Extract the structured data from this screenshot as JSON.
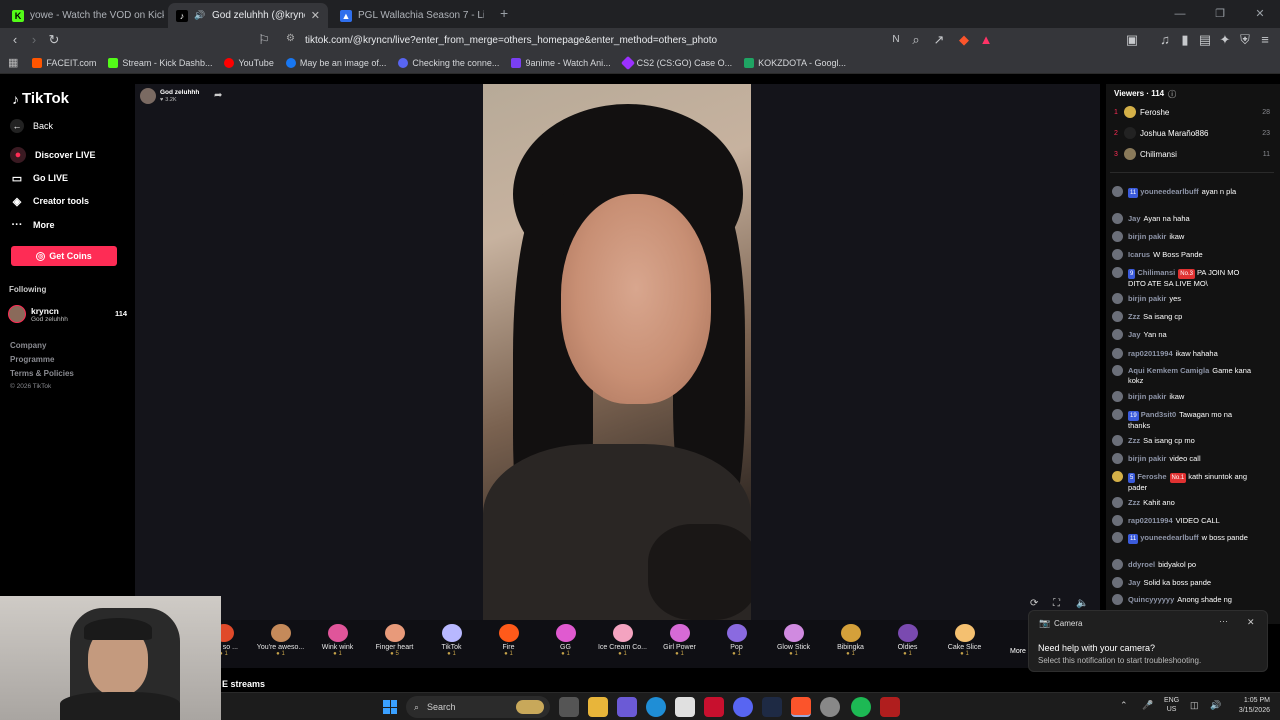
{
  "tabs": [
    {
      "title": "yowe - Watch the VOD on Kick",
      "icon": "kick-icon",
      "color": "#53fc18"
    },
    {
      "title": "God zeluhhh (@kryncn) is LIV",
      "icon": "tiktok-icon",
      "color": "#000000"
    },
    {
      "title": "PGL Wallachia Season 7 - Liquipedia",
      "icon": "liquipedia-icon",
      "color": "#2f6fed"
    }
  ],
  "url": "tiktok.com/@kryncn/live?enter_from_merge=others_homepage&enter_method=others_photo",
  "bookmarks": [
    {
      "label": "FACEIT.com",
      "color": "#ff5500"
    },
    {
      "label": "Stream - Kick Dashb...",
      "color": "#53fc18"
    },
    {
      "label": "YouTube",
      "color": "#ff0000"
    },
    {
      "label": "May be an image of...",
      "color": "#1877f2"
    },
    {
      "label": "Checking the conne...",
      "color": "#5865f2"
    },
    {
      "label": "9anime - Watch Ani...",
      "color": "#7a3ff2"
    },
    {
      "label": "CS2 (CS:GO) Case O...",
      "color": "#9b30ff"
    },
    {
      "label": "KOKZDOTA - Googl...",
      "color": "#1fa463"
    }
  ],
  "nav": {
    "logo": "TikTok",
    "back": "Back",
    "discover": "Discover LIVE",
    "golive": "Go LIVE",
    "creator": "Creator tools",
    "more": "More",
    "coins": "Get Coins",
    "following": "Following",
    "follow_user": "kryncn",
    "follow_sub": "God zeluhhh",
    "follow_count": "114",
    "company": "Company",
    "programme": "Programme",
    "terms": "Terms & Policies",
    "copyright": "© 2026 TikTok"
  },
  "host": {
    "name": "God zeluhhh",
    "likes": "3.2K"
  },
  "viewers": {
    "title": "Viewers · 114",
    "top": [
      {
        "rank": "1",
        "name": "Feroshe",
        "count": "28",
        "color": "#d4b048"
      },
      {
        "rank": "2",
        "name": "Joshua Maraño886",
        "count": "23",
        "color": "#222222"
      },
      {
        "rank": "3",
        "name": "Chilimansi",
        "count": "11",
        "color": "#8a7a5a"
      }
    ]
  },
  "chat": [
    {
      "badge": "11",
      "name": "youneedearlbuff",
      "text": "ayan n pla"
    },
    {
      "badge": "",
      "name": "Jay",
      "text": "Ayan na haha"
    },
    {
      "badge": "",
      "name": "birjin pakir",
      "text": "ikaw"
    },
    {
      "badge": "",
      "name": "Icarus",
      "text": "W Boss Pande"
    },
    {
      "badge": "9",
      "name": "Chilimansi",
      "badge2": "No.3",
      "text": "PA JOIN MO DITO ATE SA LIVE MO\\"
    },
    {
      "badge": "",
      "name": "birjin pakir",
      "text": "yes"
    },
    {
      "badge": "",
      "name": "Zzz",
      "text": "Sa isang cp"
    },
    {
      "badge": "",
      "name": "Jay",
      "text": "Yan na"
    },
    {
      "badge": "",
      "name": "rap02011994",
      "text": "ikaw hahaha"
    },
    {
      "badge": "",
      "name": "Aqui Kemkem Camigla",
      "text": "Game kana kokz"
    },
    {
      "badge": "",
      "name": "birjin pakir",
      "text": "ikaw"
    },
    {
      "badge": "19",
      "name": "Pand3sit0",
      "text": "Tawagan mo na thanks"
    },
    {
      "badge": "",
      "name": "Zzz",
      "text": "Sa isang cp mo"
    },
    {
      "badge": "",
      "name": "birjin pakir",
      "text": "video call"
    },
    {
      "badge": "5",
      "name": "Feroshe",
      "badge2": "No.1",
      "text": "kath sinuntok ang pader"
    },
    {
      "badge": "",
      "name": "Zzz",
      "text": "Kahit ano"
    },
    {
      "badge": "",
      "name": "rap02011994",
      "text": "VIDEO CALL"
    },
    {
      "badge": "11",
      "name": "youneedearlbuff",
      "text": "w boss pande"
    },
    {
      "badge": "",
      "name": "ddyroel",
      "text": "bidyakol po"
    },
    {
      "badge": "",
      "name": "Jay",
      "text": "Solid ka boss pande"
    },
    {
      "badge": "",
      "name": "Quincyyyyyy",
      "text": "Anong shade ng"
    }
  ],
  "gifts": [
    {
      "name": "You so ...",
      "price": "1",
      "color": "#e04a2a"
    },
    {
      "name": "You're aweso...",
      "price": "1",
      "color": "#c58a5a"
    },
    {
      "name": "Wink wink",
      "price": "1",
      "color": "#e0559a"
    },
    {
      "name": "Finger heart",
      "price": "5",
      "color": "#e89a7a"
    },
    {
      "name": "TikTok",
      "price": "1",
      "color": "#b8b8ff"
    },
    {
      "name": "Fire",
      "price": "1",
      "color": "#ff5a1a"
    },
    {
      "name": "GG",
      "price": "1",
      "color": "#e05ad0"
    },
    {
      "name": "Ice Cream Co...",
      "price": "1",
      "color": "#f4a3c0"
    },
    {
      "name": "Girl Power",
      "price": "1",
      "color": "#d66ad6"
    },
    {
      "name": "Pop",
      "price": "1",
      "color": "#8a6ae0"
    },
    {
      "name": "Glow Stick",
      "price": "1",
      "color": "#d08ae0"
    },
    {
      "name": "Bibingka",
      "price": "1",
      "color": "#d4a03a"
    },
    {
      "name": "Oldies",
      "price": "1",
      "color": "#7a4ab0"
    },
    {
      "name": "Cake Slice",
      "price": "1",
      "color": "#f4c070"
    }
  ],
  "gifts_more": "More",
  "streams_label": "E streams",
  "notification": {
    "app": "Camera",
    "title": "Need help with your camera?",
    "body": "Select this notification to start troubleshooting."
  },
  "taskbar": {
    "search": "Search",
    "lang": "ENG",
    "region": "US",
    "time": "1:05 PM",
    "date": "3/15/2026"
  }
}
